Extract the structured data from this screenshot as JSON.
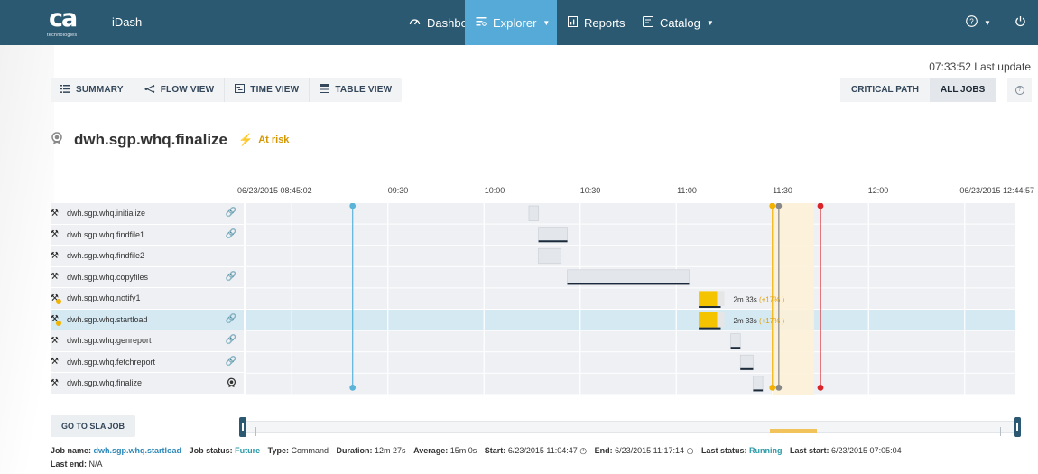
{
  "navbar": {
    "logo_text": "ca",
    "logo_sub": "technologies",
    "app_title": "iDash",
    "items": [
      {
        "label": "Dashboard",
        "icon": "dashboard-icon"
      },
      {
        "label": "Explorer",
        "icon": "explorer-icon",
        "active": true
      },
      {
        "label": "Reports",
        "icon": "reports-icon"
      },
      {
        "label": "Catalog",
        "icon": "catalog-icon"
      }
    ],
    "help_icon": "help-icon",
    "power_icon": "power-icon"
  },
  "toolbar": {
    "last_update": "07:33:52 Last update",
    "views": [
      "SUMMARY",
      "FLOW VIEW",
      "TIME VIEW",
      "TABLE VIEW"
    ],
    "paths": [
      "CRITICAL PATH",
      "ALL JOBS"
    ],
    "active_path": "ALL JOBS"
  },
  "job": {
    "name": "dwh.sgp.whq.finalize",
    "status": "At risk"
  },
  "timeline": {
    "start_label": "06/23/2015 08:45:02",
    "end_label": "06/23/2015 12:44:57",
    "ticks": [
      "09:30",
      "10:00",
      "10:30",
      "11:00",
      "11:30",
      "12:00"
    ]
  },
  "tasks": [
    {
      "name": "dwh.sgp.whq.initialize",
      "link": true
    },
    {
      "name": "dwh.sgp.whq.findfile1",
      "link": true
    },
    {
      "name": "dwh.sgp.whq.findfile2",
      "link": false
    },
    {
      "name": "dwh.sgp.whq.copyfiles",
      "link": true
    },
    {
      "name": "dwh.sgp.whq.notify1",
      "link": false,
      "warning": true
    },
    {
      "name": "dwh.sgp.whq.startload",
      "link": true,
      "warning": true,
      "selected": true
    },
    {
      "name": "dwh.sgp.whq.genreport",
      "link": true
    },
    {
      "name": "dwh.sgp.whq.fetchreport",
      "link": true
    },
    {
      "name": "dwh.sgp.whq.finalize",
      "link": false,
      "target": true
    }
  ],
  "gantt_bars": [
    {
      "row": 0,
      "start": "10:14",
      "end": "10:17",
      "actual": false
    },
    {
      "row": 1,
      "start": "10:17",
      "end": "10:26",
      "actual": true
    },
    {
      "row": 2,
      "start": "10:17",
      "end": "10:24",
      "actual": false
    },
    {
      "row": 3,
      "start": "10:26",
      "end": "11:04",
      "actual": true
    },
    {
      "row": 4,
      "start": "11:07",
      "end": "11:15",
      "late": true,
      "annotation": "2m 33s",
      "pct": "(+17% )"
    },
    {
      "row": 5,
      "start": "11:07",
      "end": "11:15",
      "late": true,
      "annotation": "2m 33s",
      "pct": "(+17% )"
    },
    {
      "row": 6,
      "start": "11:17",
      "end": "11:20",
      "actual": true
    },
    {
      "row": 7,
      "start": "11:20",
      "end": "11:24",
      "actual": true
    },
    {
      "row": 8,
      "start": "11:24",
      "end": "11:27",
      "actual": true
    }
  ],
  "bottom": {
    "sla_button": "GO TO SLA JOB",
    "job_name_label": "Job name:",
    "job_name": "dwh.sgp.whq.startload",
    "job_status_label": "Job status:",
    "job_status": "Future",
    "type_label": "Type:",
    "type": "Command",
    "duration_label": "Duration:",
    "duration": "12m 27s",
    "average_label": "Average:",
    "average": "15m 0s",
    "start_label": "Start:",
    "start": "6/23/2015 11:04:47",
    "end_label": "End:",
    "end": "6/23/2015 11:17:14",
    "last_status_label": "Last status:",
    "last_status": "Running",
    "last_start_label": "Last start:",
    "last_start": "6/23/2015 07:05:04",
    "last_end_label": "Last end:",
    "last_end": "N/A"
  },
  "colors": {
    "navbar": "#2c5972",
    "active_nav": "#56aad7",
    "late": "#f5c400",
    "now_line": "#5ab4d9",
    "sla_line": "#d9252a",
    "risk": "#d49700"
  }
}
